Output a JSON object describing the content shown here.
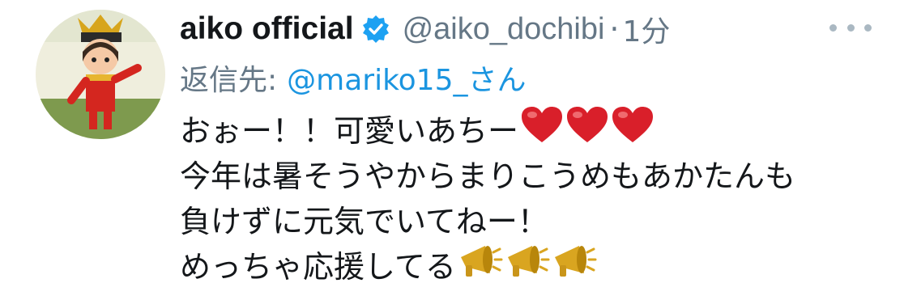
{
  "tweet": {
    "display_name": "aiko official",
    "handle": "@aiko_dochibi",
    "separator": "·",
    "time": "1分",
    "reply_prefix": "返信先:",
    "reply_mention": "@mariko15_さん",
    "lines": [
      "おぉー！！可愛いあちー",
      "今年は暑そうやからまりこうめもあかたんも",
      "負けずに元気でいてねー！",
      "めっちゃ応援してる"
    ],
    "line1_emoji": [
      "heart-icon",
      "heart-icon",
      "heart-icon"
    ],
    "line4_emoji": [
      "megaphone-icon",
      "megaphone-icon",
      "megaphone-icon"
    ]
  },
  "colors": {
    "text": "#14171a",
    "muted": "#657786",
    "link": "#1b95e0",
    "verified": "#1da1f2",
    "heart": "#d91f2a",
    "megaphone": "#d9a520"
  }
}
